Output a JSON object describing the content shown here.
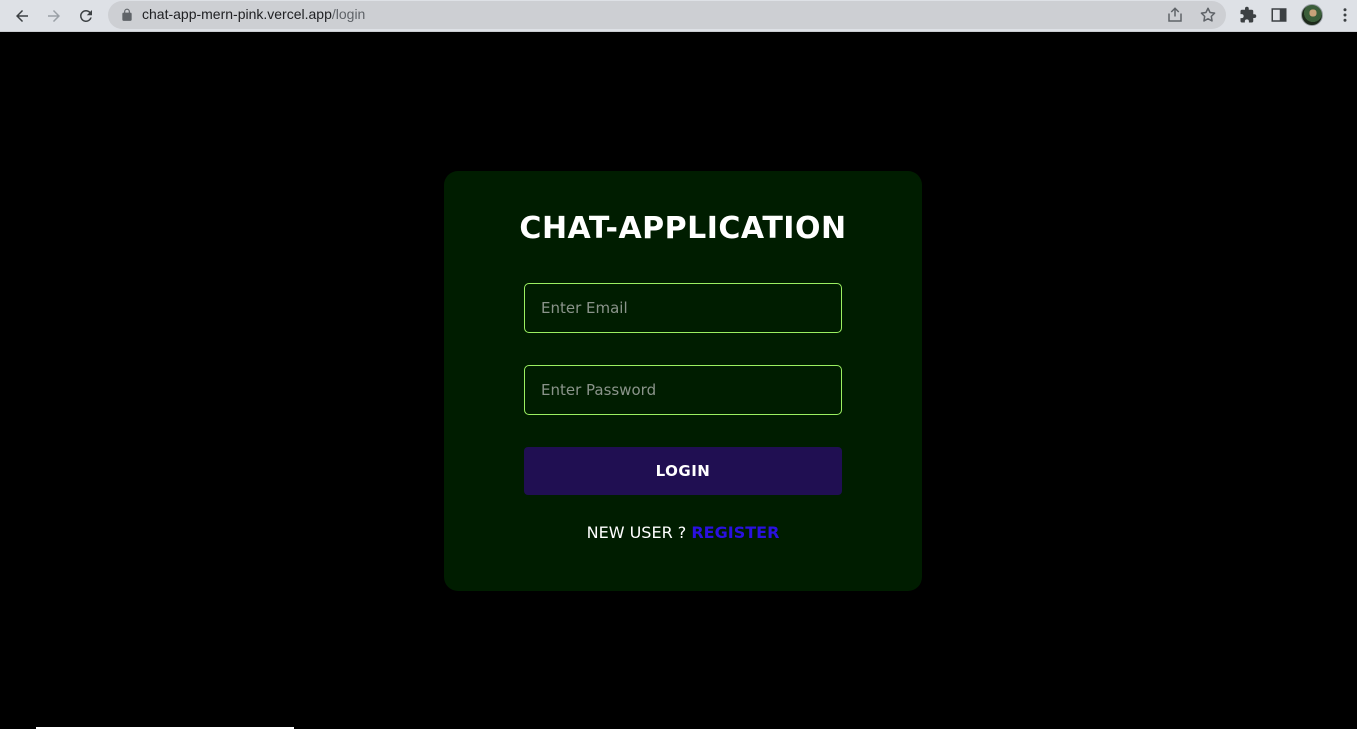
{
  "browser": {
    "url_domain": "chat-app-mern-pink.vercel.app",
    "url_path": "/login"
  },
  "login_card": {
    "title": "CHAT-APPLICATION",
    "email_placeholder": "Enter Email",
    "password_placeholder": "Enter Password",
    "login_button": "LOGIN",
    "new_user_text": "NEW USER ?",
    "register_link": "REGISTER"
  },
  "colors": {
    "page_background": "#000000",
    "card_background": "#001d00",
    "input_border": "#9bf061",
    "button_background": "#200f52",
    "register_link": "#2a10e0"
  }
}
